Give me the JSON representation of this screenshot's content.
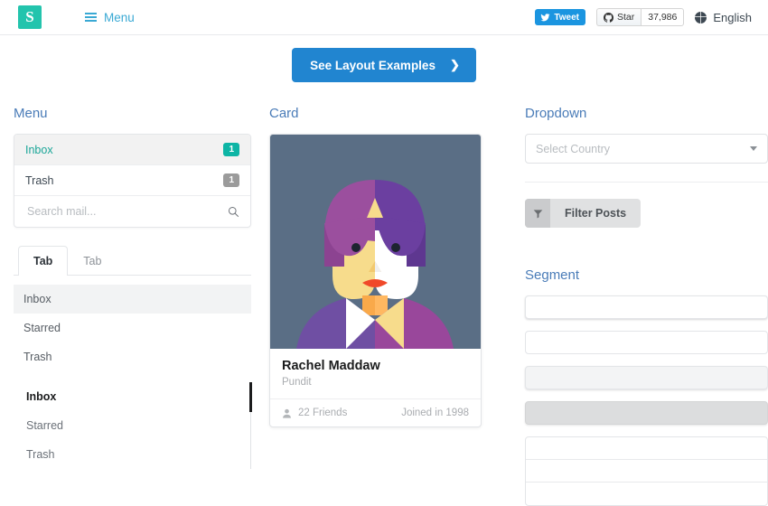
{
  "header": {
    "logo_text": "S",
    "menu_label": "Menu",
    "tweet_label": "Tweet",
    "github_star_label": "Star",
    "github_star_count": "37,986",
    "language_label": "English"
  },
  "cta": {
    "label": "See Layout Examples",
    "chevron": "❯"
  },
  "menu_section": {
    "title": "Menu",
    "items": [
      {
        "label": "Inbox",
        "badge": "1",
        "active": true
      },
      {
        "label": "Trash",
        "badge": "1",
        "active": false
      }
    ],
    "search_placeholder": "Search mail...",
    "tabs": [
      {
        "label": "Tab",
        "active": true
      },
      {
        "label": "Tab",
        "active": false
      }
    ],
    "plain_list": [
      {
        "label": "Inbox",
        "selected": true
      },
      {
        "label": "Starred",
        "selected": false
      },
      {
        "label": "Trash",
        "selected": false
      }
    ],
    "rail_list": [
      {
        "label": "Inbox",
        "current": true
      },
      {
        "label": "Starred",
        "current": false
      },
      {
        "label": "Trash",
        "current": false
      }
    ]
  },
  "card_section": {
    "title": "Card",
    "name": "Rachel Maddaw",
    "role": "Pundit",
    "friends": "22 Friends",
    "joined": "Joined in 1998",
    "avatar_colors": {
      "background": "#5a6e85",
      "hair_left": "#9b4f9e",
      "hair_right": "#6b3fa0",
      "skin_left": "#f7dc8c",
      "skin_right": "#ffffff",
      "ear": "#f9a94a",
      "lips": "#f0492a",
      "shirt_left": "#6f4fa3",
      "shirt_right": "#99479b"
    }
  },
  "dropdown_section": {
    "title": "Dropdown",
    "select_placeholder": "Select Country",
    "filter_label": "Filter Posts",
    "filter_icon": "▼"
  },
  "segment_section": {
    "title": "Segment",
    "segments": [
      {
        "variant": "raised"
      },
      {
        "variant": "plain"
      },
      {
        "variant": "secondary"
      },
      {
        "variant": "tertiary"
      }
    ],
    "group_count": 3
  },
  "colors": {
    "brand_teal": "#23c4ad",
    "heading_blue": "#4a7cb8",
    "cta_blue": "#2185d0",
    "nav_blue": "#3aa9d4"
  }
}
